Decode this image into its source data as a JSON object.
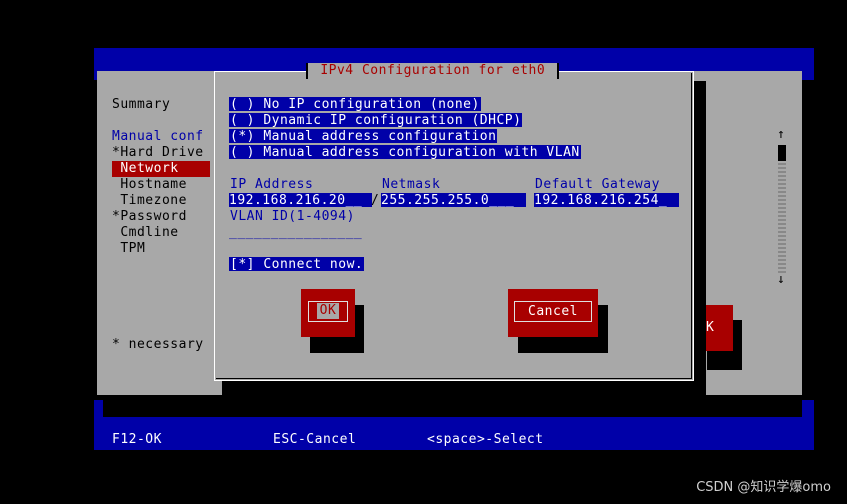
{
  "dialog": {
    "title": " IPv4 Configuration for eth0 ",
    "options": [
      {
        "marker": "( )",
        "label": "No IP configuration (none)"
      },
      {
        "marker": "( )",
        "label": "Dynamic IP configuration (DHCP)"
      },
      {
        "marker": "(*)",
        "label": "Manual address configuration"
      },
      {
        "marker": "( )",
        "label": "Manual address configuration with VLAN"
      }
    ],
    "fields": {
      "ip_label": "IP Address",
      "ip_value": "192.168.216.20__",
      "netmask_label": "Netmask",
      "netmask_value": "255.255.255.0___",
      "gateway_label": "Default Gateway",
      "gateway_value": "192.168.216.254_",
      "separator": "/",
      "vlan_label": "VLAN ID(1-4094)",
      "vlan_value": "________________"
    },
    "connect": {
      "marker": "[*]",
      "label": "Connect now."
    },
    "ok_label": "OK",
    "cancel_label": "Cancel"
  },
  "sidebar": {
    "items": [
      {
        "text": "Summary"
      },
      {
        "text": "Manual conf"
      },
      {
        "text": "*Hard Drive"
      },
      {
        "text": " Network"
      },
      {
        "text": " Hostname"
      },
      {
        "text": " Timezone"
      },
      {
        "text": "*Password"
      },
      {
        "text": " Cmdline"
      },
      {
        "text": " TPM"
      }
    ],
    "note": "* necessary"
  },
  "background_button": "K",
  "scroll": {
    "up": "↑",
    "down": "↓"
  },
  "footer": {
    "f12": "F12-OK",
    "esc": "ESC-Cancel",
    "space": "<space>-Select"
  },
  "watermark": "CSDN @知识学爆omo",
  "colors": {
    "blue": "#0000a8",
    "gray": "#a8a8a8",
    "red": "#a80000",
    "white": "#ffffff",
    "black": "#000000"
  }
}
